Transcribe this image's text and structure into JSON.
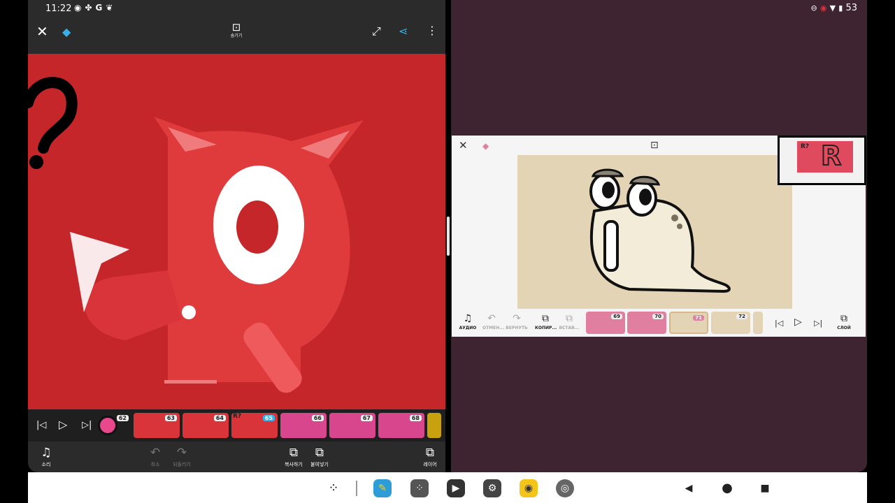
{
  "status": {
    "time": "11:22",
    "left_icons": [
      "record-icon",
      "fan-icon",
      "google-icon",
      "leaf-icon"
    ],
    "battery": "53"
  },
  "left_app": {
    "hide_label": "숨기기",
    "canvas_bg": "#c42629",
    "frames": [
      {
        "num": "62",
        "color": "#d94f86"
      },
      {
        "num": "63",
        "color": "#d8343a"
      },
      {
        "num": "64",
        "color": "#d8343a"
      },
      {
        "num": "65",
        "color": "#d8343a",
        "active": true
      },
      {
        "num": "66",
        "color": "#d8478e"
      },
      {
        "num": "67",
        "color": "#d8478e"
      },
      {
        "num": "68",
        "color": "#d8478e"
      }
    ],
    "tools": {
      "sound": "소리",
      "undo": "취소",
      "redo": "되돌리기",
      "copy": "복사하기",
      "paste": "붙여넣기",
      "layer": "레이어"
    }
  },
  "right_app": {
    "tools": {
      "audio": "АУДИО",
      "undo": "ОТМЕН...",
      "redo": "ВЕРНУТЬ",
      "copy": "КОПИР...",
      "paste": "ВСТАВ...",
      "layer": "СЛОЙ"
    },
    "frames": [
      {
        "num": "69",
        "color": "#e07fa0"
      },
      {
        "num": "70",
        "color": "#e07fa0"
      },
      {
        "num": "71",
        "color": "#e4d4b6",
        "active": true
      },
      {
        "num": "72",
        "color": "#e4d4b6"
      }
    ],
    "pip_label": "R?"
  },
  "left_frame_label": "R?",
  "colors": {
    "accent": "#3ab0e8",
    "right_bg": "#3e2431"
  }
}
